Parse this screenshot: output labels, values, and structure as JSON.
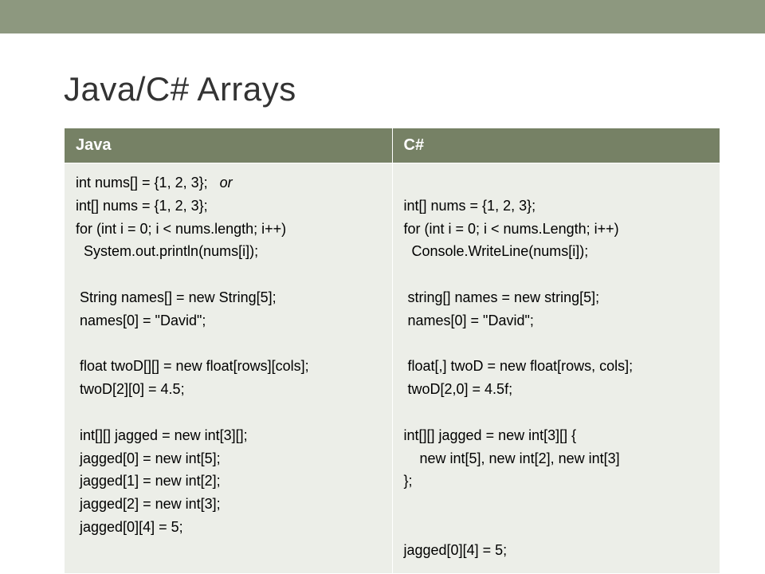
{
  "title": "Java/C# Arrays",
  "headers": {
    "java": "Java",
    "csharp": "C#"
  },
  "java": {
    "l1a": "int nums[] = {1, 2, 3};",
    "l1b": "or",
    "l2": "int[] nums = {1, 2, 3};",
    "l3": "for (int i = 0; i < nums.length; i++)",
    "l4": "  System.out.println(nums[i]);",
    "l5": "",
    "l6": " String names[] = new String[5];",
    "l7": " names[0] = \"David\";",
    "l8": "",
    "l9": " float twoD[][] = new float[rows][cols];",
    "l10": " twoD[2][0] = 4.5;",
    "l11": "",
    "l12": " int[][] jagged = new int[3][];",
    "l13": " jagged[0] = new int[5];",
    "l14": " jagged[1] = new int[2];",
    "l15": " jagged[2] = new int[3];",
    "l16": " jagged[0][4] = 5;"
  },
  "csharp": {
    "l1": "",
    "l2": "int[] nums = {1, 2, 3};",
    "l3": "for (int i = 0; i < nums.Length; i++)",
    "l4": "  Console.WriteLine(nums[i]);",
    "l5": "",
    "l6": " string[] names = new string[5];",
    "l7": " names[0] = \"David\";",
    "l8": "",
    "l9": " float[,] twoD = new float[rows, cols];",
    "l10": " twoD[2,0] = 4.5f;",
    "l11": "",
    "l12": "int[][] jagged = new int[3][] {",
    "l13": "    new int[5], new int[2], new int[3]",
    "l14": "};",
    "l15": "",
    "l16": "",
    "l17": "jagged[0][4] = 5;"
  }
}
